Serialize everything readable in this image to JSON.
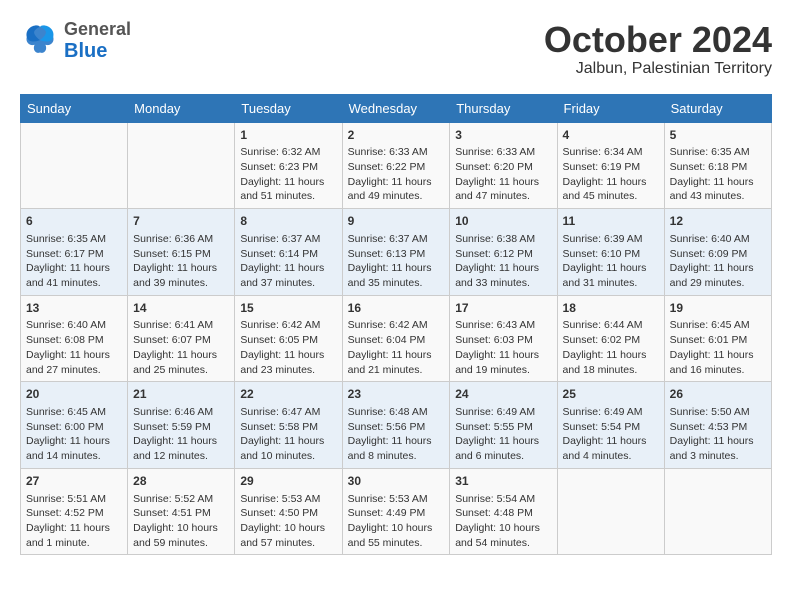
{
  "header": {
    "logo_general": "General",
    "logo_blue": "Blue",
    "month_title": "October 2024",
    "location": "Jalbun, Palestinian Territory"
  },
  "weekdays": [
    "Sunday",
    "Monday",
    "Tuesday",
    "Wednesday",
    "Thursday",
    "Friday",
    "Saturday"
  ],
  "weeks": [
    [
      {
        "day": "",
        "sunrise": "",
        "sunset": "",
        "daylight": ""
      },
      {
        "day": "",
        "sunrise": "",
        "sunset": "",
        "daylight": ""
      },
      {
        "day": "1",
        "sunrise": "Sunrise: 6:32 AM",
        "sunset": "Sunset: 6:23 PM",
        "daylight": "Daylight: 11 hours and 51 minutes."
      },
      {
        "day": "2",
        "sunrise": "Sunrise: 6:33 AM",
        "sunset": "Sunset: 6:22 PM",
        "daylight": "Daylight: 11 hours and 49 minutes."
      },
      {
        "day": "3",
        "sunrise": "Sunrise: 6:33 AM",
        "sunset": "Sunset: 6:20 PM",
        "daylight": "Daylight: 11 hours and 47 minutes."
      },
      {
        "day": "4",
        "sunrise": "Sunrise: 6:34 AM",
        "sunset": "Sunset: 6:19 PM",
        "daylight": "Daylight: 11 hours and 45 minutes."
      },
      {
        "day": "5",
        "sunrise": "Sunrise: 6:35 AM",
        "sunset": "Sunset: 6:18 PM",
        "daylight": "Daylight: 11 hours and 43 minutes."
      }
    ],
    [
      {
        "day": "6",
        "sunrise": "Sunrise: 6:35 AM",
        "sunset": "Sunset: 6:17 PM",
        "daylight": "Daylight: 11 hours and 41 minutes."
      },
      {
        "day": "7",
        "sunrise": "Sunrise: 6:36 AM",
        "sunset": "Sunset: 6:15 PM",
        "daylight": "Daylight: 11 hours and 39 minutes."
      },
      {
        "day": "8",
        "sunrise": "Sunrise: 6:37 AM",
        "sunset": "Sunset: 6:14 PM",
        "daylight": "Daylight: 11 hours and 37 minutes."
      },
      {
        "day": "9",
        "sunrise": "Sunrise: 6:37 AM",
        "sunset": "Sunset: 6:13 PM",
        "daylight": "Daylight: 11 hours and 35 minutes."
      },
      {
        "day": "10",
        "sunrise": "Sunrise: 6:38 AM",
        "sunset": "Sunset: 6:12 PM",
        "daylight": "Daylight: 11 hours and 33 minutes."
      },
      {
        "day": "11",
        "sunrise": "Sunrise: 6:39 AM",
        "sunset": "Sunset: 6:10 PM",
        "daylight": "Daylight: 11 hours and 31 minutes."
      },
      {
        "day": "12",
        "sunrise": "Sunrise: 6:40 AM",
        "sunset": "Sunset: 6:09 PM",
        "daylight": "Daylight: 11 hours and 29 minutes."
      }
    ],
    [
      {
        "day": "13",
        "sunrise": "Sunrise: 6:40 AM",
        "sunset": "Sunset: 6:08 PM",
        "daylight": "Daylight: 11 hours and 27 minutes."
      },
      {
        "day": "14",
        "sunrise": "Sunrise: 6:41 AM",
        "sunset": "Sunset: 6:07 PM",
        "daylight": "Daylight: 11 hours and 25 minutes."
      },
      {
        "day": "15",
        "sunrise": "Sunrise: 6:42 AM",
        "sunset": "Sunset: 6:05 PM",
        "daylight": "Daylight: 11 hours and 23 minutes."
      },
      {
        "day": "16",
        "sunrise": "Sunrise: 6:42 AM",
        "sunset": "Sunset: 6:04 PM",
        "daylight": "Daylight: 11 hours and 21 minutes."
      },
      {
        "day": "17",
        "sunrise": "Sunrise: 6:43 AM",
        "sunset": "Sunset: 6:03 PM",
        "daylight": "Daylight: 11 hours and 19 minutes."
      },
      {
        "day": "18",
        "sunrise": "Sunrise: 6:44 AM",
        "sunset": "Sunset: 6:02 PM",
        "daylight": "Daylight: 11 hours and 18 minutes."
      },
      {
        "day": "19",
        "sunrise": "Sunrise: 6:45 AM",
        "sunset": "Sunset: 6:01 PM",
        "daylight": "Daylight: 11 hours and 16 minutes."
      }
    ],
    [
      {
        "day": "20",
        "sunrise": "Sunrise: 6:45 AM",
        "sunset": "Sunset: 6:00 PM",
        "daylight": "Daylight: 11 hours and 14 minutes."
      },
      {
        "day": "21",
        "sunrise": "Sunrise: 6:46 AM",
        "sunset": "Sunset: 5:59 PM",
        "daylight": "Daylight: 11 hours and 12 minutes."
      },
      {
        "day": "22",
        "sunrise": "Sunrise: 6:47 AM",
        "sunset": "Sunset: 5:58 PM",
        "daylight": "Daylight: 11 hours and 10 minutes."
      },
      {
        "day": "23",
        "sunrise": "Sunrise: 6:48 AM",
        "sunset": "Sunset: 5:56 PM",
        "daylight": "Daylight: 11 hours and 8 minutes."
      },
      {
        "day": "24",
        "sunrise": "Sunrise: 6:49 AM",
        "sunset": "Sunset: 5:55 PM",
        "daylight": "Daylight: 11 hours and 6 minutes."
      },
      {
        "day": "25",
        "sunrise": "Sunrise: 6:49 AM",
        "sunset": "Sunset: 5:54 PM",
        "daylight": "Daylight: 11 hours and 4 minutes."
      },
      {
        "day": "26",
        "sunrise": "Sunrise: 5:50 AM",
        "sunset": "Sunset: 4:53 PM",
        "daylight": "Daylight: 11 hours and 3 minutes."
      }
    ],
    [
      {
        "day": "27",
        "sunrise": "Sunrise: 5:51 AM",
        "sunset": "Sunset: 4:52 PM",
        "daylight": "Daylight: 11 hours and 1 minute."
      },
      {
        "day": "28",
        "sunrise": "Sunrise: 5:52 AM",
        "sunset": "Sunset: 4:51 PM",
        "daylight": "Daylight: 10 hours and 59 minutes."
      },
      {
        "day": "29",
        "sunrise": "Sunrise: 5:53 AM",
        "sunset": "Sunset: 4:50 PM",
        "daylight": "Daylight: 10 hours and 57 minutes."
      },
      {
        "day": "30",
        "sunrise": "Sunrise: 5:53 AM",
        "sunset": "Sunset: 4:49 PM",
        "daylight": "Daylight: 10 hours and 55 minutes."
      },
      {
        "day": "31",
        "sunrise": "Sunrise: 5:54 AM",
        "sunset": "Sunset: 4:48 PM",
        "daylight": "Daylight: 10 hours and 54 minutes."
      },
      {
        "day": "",
        "sunrise": "",
        "sunset": "",
        "daylight": ""
      },
      {
        "day": "",
        "sunrise": "",
        "sunset": "",
        "daylight": ""
      }
    ]
  ]
}
